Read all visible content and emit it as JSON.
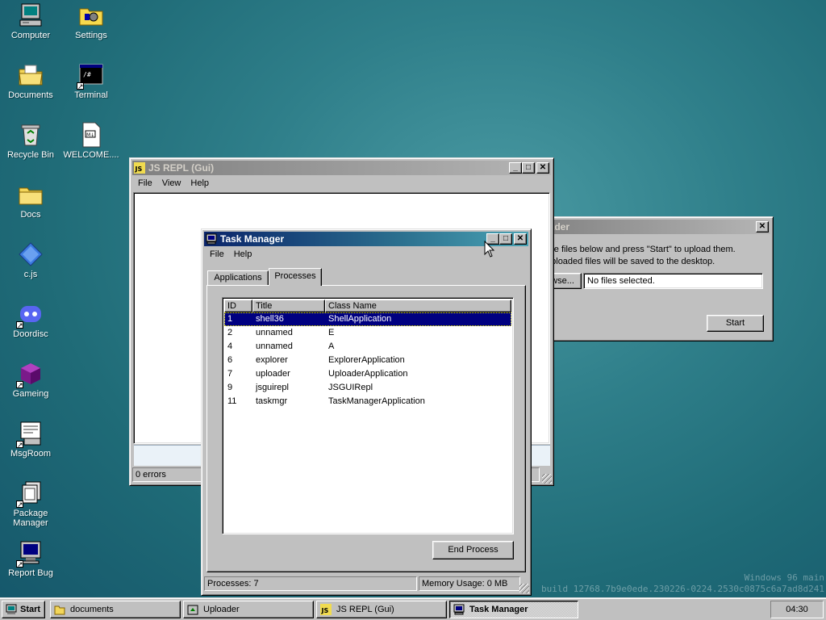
{
  "desktop": {
    "icons": [
      {
        "label": "Computer"
      },
      {
        "label": "Settings"
      },
      {
        "label": "Documents"
      },
      {
        "label": "Terminal"
      },
      {
        "label": "Recycle Bin"
      },
      {
        "label": "WELCOME...."
      },
      {
        "label": "Docs"
      },
      {
        "label": "c.js"
      },
      {
        "label": "Doordisc"
      },
      {
        "label": "Gameing"
      },
      {
        "label": "MsgRoom"
      },
      {
        "label": "Package Manager"
      },
      {
        "label": "Report Bug"
      }
    ],
    "watermark_line1": "Windows 96 main",
    "watermark_line2": "build 12768.7b9e0ede.230226-0224.2530c0875c6a7ad8d241"
  },
  "repl": {
    "title": "JS REPL (Gui)",
    "menu": [
      "File",
      "View",
      "Help"
    ],
    "status": "0 errors"
  },
  "uploader": {
    "title": "Uploader",
    "line1": "Choose files below and press \"Start\" to upload them.",
    "line2": "The uploaded files will be saved to the desktop.",
    "browse_label": "Browse...",
    "file_value": "No files selected.",
    "start_label": "Start"
  },
  "taskmgr": {
    "title": "Task Manager",
    "menu": [
      "File",
      "Help"
    ],
    "tabs": [
      "Applications",
      "Processes"
    ],
    "active_tab": "Processes",
    "columns": [
      "ID",
      "Title",
      "Class Name"
    ],
    "rows": [
      {
        "id": "1",
        "title": "shell36",
        "class": "ShellApplication"
      },
      {
        "id": "2",
        "title": "unnamed",
        "class": "E"
      },
      {
        "id": "4",
        "title": "unnamed",
        "class": "A"
      },
      {
        "id": "6",
        "title": "explorer",
        "class": "ExplorerApplication"
      },
      {
        "id": "7",
        "title": "uploader",
        "class": "UploaderApplication"
      },
      {
        "id": "9",
        "title": "jsguirepl",
        "class": "JSGUIRepl"
      },
      {
        "id": "11",
        "title": "taskmgr",
        "class": "TaskManagerApplication"
      }
    ],
    "end_process_label": "End Process",
    "status_processes": "Processes: 7",
    "status_memory": "Memory Usage: 0 MB"
  },
  "taskbar": {
    "start_label": "Start",
    "items": [
      {
        "label": "documents"
      },
      {
        "label": "Uploader"
      },
      {
        "label": "JS REPL (Gui)"
      },
      {
        "label": "Task Manager"
      }
    ],
    "clock": "04:30"
  }
}
